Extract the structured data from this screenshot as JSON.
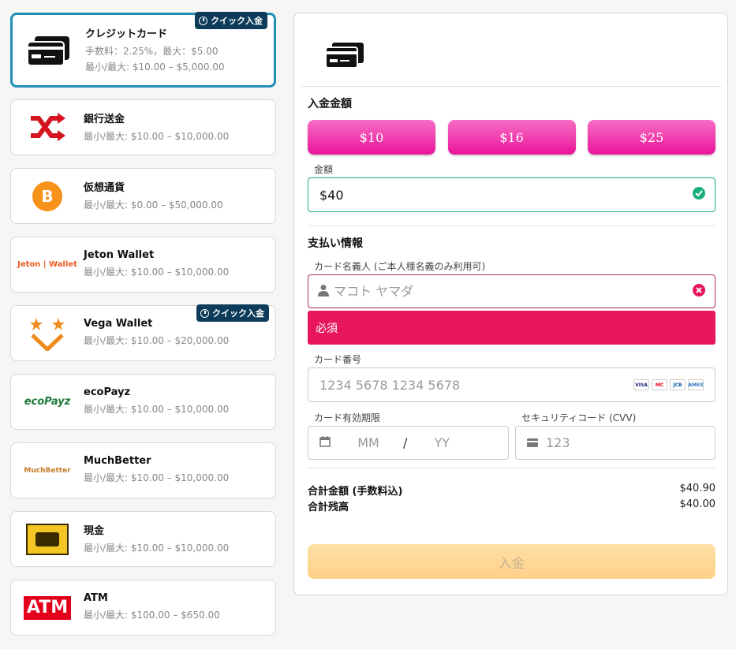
{
  "methods": [
    {
      "name": "クレジットカード",
      "fee": "手数料：2.25%，最大：$5.00",
      "limits": "最小/最大: $10.00 – $5,000.00",
      "badge": "クイック入金",
      "icon": "credit-card-icon"
    },
    {
      "name": "銀行送金",
      "limits": "最小/最大: $10.00 – $10,000.00",
      "icon": "shuffle-arrows-icon"
    },
    {
      "name": "仮想通貨",
      "limits": "最小/最大: $0.00 – $50,000.00",
      "icon": "bitcoin-icon"
    },
    {
      "name": "Jeton Wallet",
      "limits": "最小/最大: $10.00 – $10,000.00",
      "logo_text": "Jeton | Wallet",
      "icon": "jeton-wallet-logo"
    },
    {
      "name": "Vega Wallet",
      "limits": "最小/最大: $10.00 – $20,000.00",
      "badge": "クイック入金",
      "icon": "vega-wallet-logo"
    },
    {
      "name": "ecoPayz",
      "limits": "最小/最大: $10.00 – $10,000.00",
      "logo_text": "ecoPayz",
      "icon": "ecopayz-logo"
    },
    {
      "name": "MuchBetter",
      "limits": "最小/最大: $10.00 – $10,000.00",
      "logo_text": "MuchBetter",
      "icon": "muchbetter-logo"
    },
    {
      "name": "現金",
      "limits": "最小/最大: $10.00 – $10,000.00",
      "icon": "cash-logo"
    },
    {
      "name": "ATM",
      "limits": "最小/最大: $100.00 – $650.00",
      "logo_text": "ATM",
      "icon": "atm-logo"
    }
  ],
  "deposit": {
    "title": "入金金額",
    "quick_amounts": [
      "$10",
      "$16",
      "$25"
    ],
    "amount_label": "金額",
    "amount_value": "$40"
  },
  "payment": {
    "title": "支払い情報",
    "holder_label": "カード名義人 (ご本人様名義のみ利用可)",
    "holder_placeholder": "マコト ヤマダ",
    "error": "必須",
    "card_label": "カード番号",
    "card_placeholder": "1234 5678 1234 5678",
    "card_brands": [
      "VISA",
      "MC",
      "JCB",
      "AMEX"
    ],
    "expiry_label": "カード有効期限",
    "month_placeholder": "MM",
    "separator": "/",
    "year_placeholder": "YY",
    "cvv_label": "セキュリティコード (CVV)",
    "cvv_placeholder": "123"
  },
  "totals": {
    "total_label": "合計金額 (手数料込)",
    "total_value": "$40.90",
    "balance_label": "合計残高",
    "balance_value": "$40.00"
  },
  "submit_label": "入金",
  "colors": {
    "accent_pink": "#e9149a",
    "selected_border": "#1f8fb3",
    "badge_bg": "#0d3b5a",
    "error": "#e8175d",
    "valid": "#1aaf7a",
    "submit": "#ffd089"
  }
}
